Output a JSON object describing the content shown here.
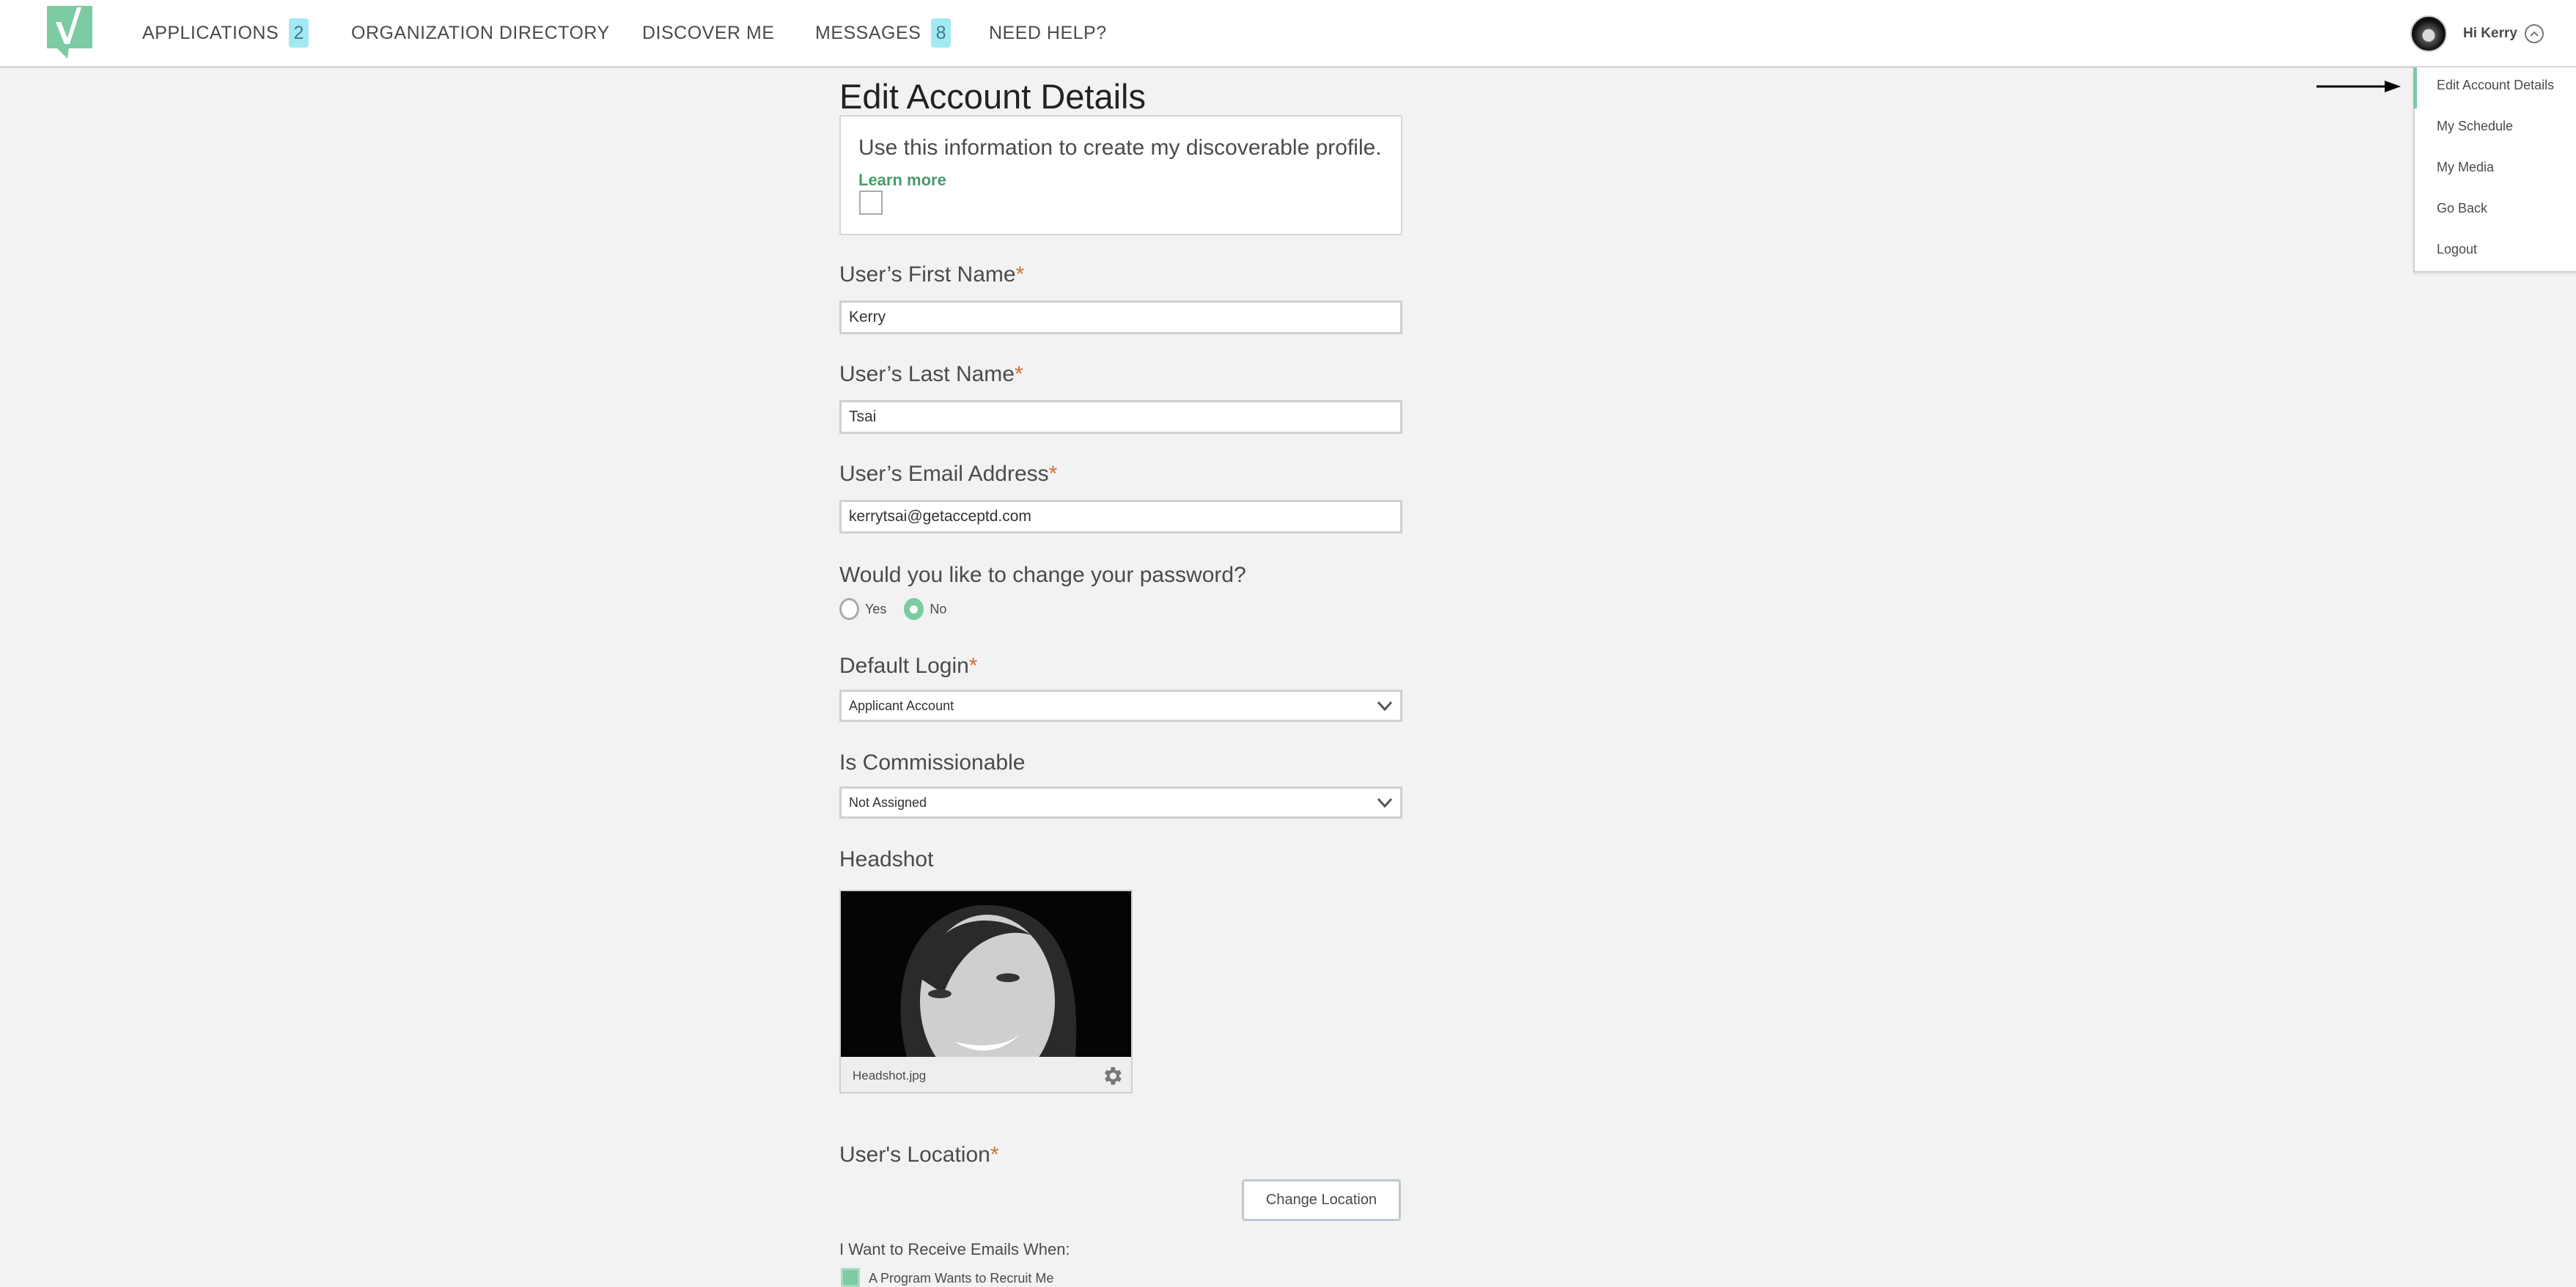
{
  "header": {
    "nav": [
      {
        "label": "APPLICATIONS",
        "badge": "2"
      },
      {
        "label": "ORGANIZATION DIRECTORY"
      },
      {
        "label": "DISCOVER ME"
      },
      {
        "label": "MESSAGES",
        "badge": "8"
      },
      {
        "label": "NEED HELP?"
      }
    ],
    "greeting": "Hi Kerry"
  },
  "user_menu": {
    "items": [
      {
        "label": "Edit Account Details",
        "active": true
      },
      {
        "label": "My Schedule"
      },
      {
        "label": "My Media"
      },
      {
        "label": "Go Back"
      },
      {
        "label": "Logout"
      }
    ]
  },
  "page": {
    "title": "Edit Account Details",
    "profile_box": {
      "text": "Use this information to create my discoverable profile.",
      "link": "Learn more",
      "checked": false
    },
    "required_marker": "*",
    "first_name": {
      "label": "User’s First Name",
      "value": "Kerry"
    },
    "last_name": {
      "label": "User’s Last Name",
      "value": "Tsai"
    },
    "email": {
      "label": "User’s Email Address",
      "value": "kerrytsai@getacceptd.com"
    },
    "password": {
      "label": "Would you like to change your password?",
      "options": [
        "Yes",
        "No"
      ],
      "selected": "No"
    },
    "default_login": {
      "label": "Default Login",
      "value": "Applicant Account"
    },
    "commissionable": {
      "label": "Is Commissionable",
      "value": "Not Assigned"
    },
    "headshot": {
      "label": "Headshot",
      "filename": "Headshot.jpg"
    },
    "location": {
      "label": "User's Location",
      "button": "Change Location"
    },
    "emails": {
      "label": "I Want to Receive Emails When:",
      "options": [
        {
          "label": "A Program Wants to Recruit Me",
          "checked": true
        }
      ]
    }
  },
  "colors": {
    "brand_green": "#7ccba3",
    "badge_bg": "#a3e9f4",
    "required": "#d2703a",
    "link_green": "#4a9a6a"
  }
}
